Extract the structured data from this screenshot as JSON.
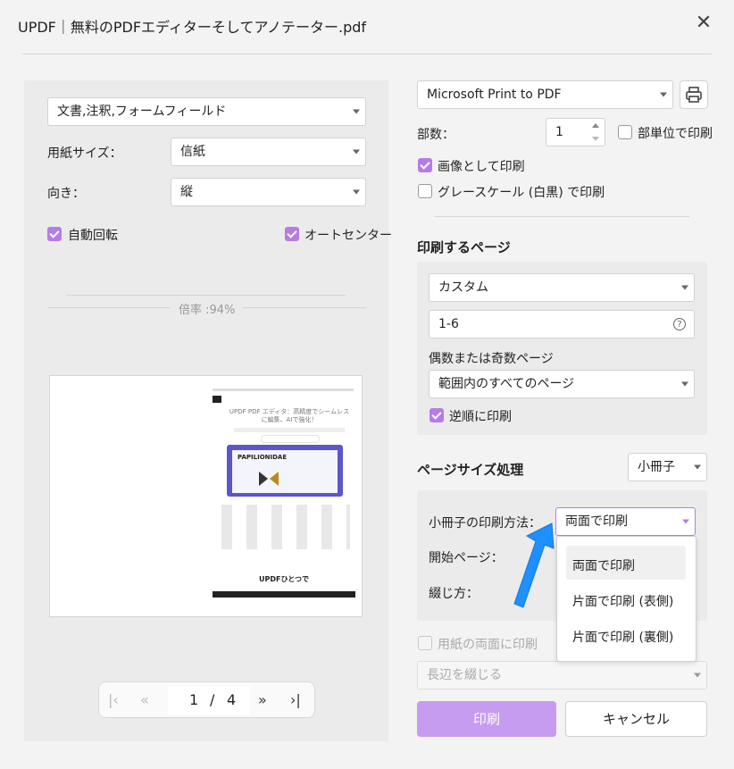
{
  "window": {
    "title": "UPDF｜無料のPDFエディターそしてアノテーター.pdf"
  },
  "left": {
    "content_select": "文書,注釈,フォームフィールド",
    "paper_size_label": "用紙サイズ：",
    "paper_size_value": "信紙",
    "orientation_label": "向き：",
    "orientation_value": "縦",
    "auto_rotate_label": "自動回転",
    "auto_center_label": "オートセンター",
    "zoom_label": "倍率 :94%"
  },
  "preview": {
    "heading": "UPDF PDF エディタ：高精度でシームレスに編集、AIで強化！",
    "image_text": "PAPILIONIDAE",
    "footer_heading": "UPDFひとつで"
  },
  "pager": {
    "current": "1",
    "separator": "/",
    "total": "4"
  },
  "right": {
    "printer": "Microsoft Print to PDF",
    "copies_label": "部数：",
    "copies_value": "1",
    "collate_label": "部単位で印刷",
    "print_as_image_label": "画像として印刷",
    "grayscale_label": "グレースケール (白黒) で印刷",
    "pages_section_title": "印刷するページ",
    "pages_mode": "カスタム",
    "pages_range": "1-6",
    "odd_even_label": "偶数または奇数ページ",
    "odd_even_value": "範囲内のすべてのページ",
    "reverse_label": "逆順に印刷",
    "page_sizing_title": "ページサイズ処理",
    "page_sizing_value": "小冊子",
    "booklet_method_label": "小冊子の印刷方法：",
    "booklet_method_value": "両面で印刷",
    "start_page_label": "開始ページ：",
    "binding_label": "綴じ方：",
    "duplex_label": "用紙の両面に印刷",
    "edge_value": "長辺を綴じる",
    "dropdown_options": [
      "両面で印刷",
      "片面で印刷 (表側)",
      "片面で印刷 (裏側)"
    ],
    "print_button": "印刷",
    "cancel_button": "キャンセル"
  },
  "colors": {
    "accent": "#b67ce6",
    "arrow": "#1e90ff"
  }
}
